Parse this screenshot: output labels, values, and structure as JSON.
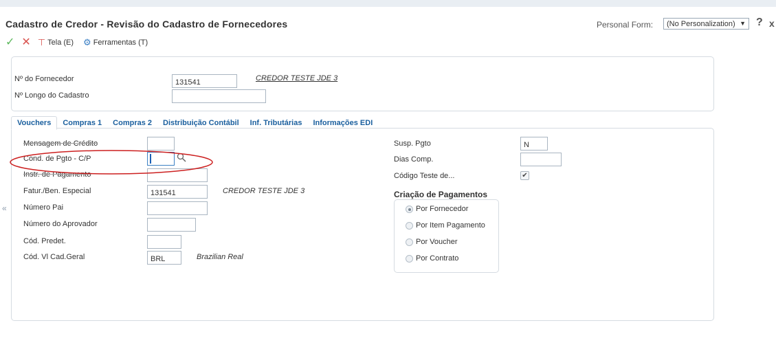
{
  "page": {
    "title": "Cadastro de Credor - Revisão do Cadastro de Fornecedores",
    "personal_form_label": "Personal Form:",
    "personal_form_value": "(No Personalization)",
    "help_glyph": "?",
    "close_glyph": "x"
  },
  "toolbar": {
    "ok_icon": "checkmark-icon",
    "cancel_icon": "x-icon",
    "tela_label": "Tela (E)",
    "ferramentas_label": "Ferramentas (T)"
  },
  "header": {
    "supplier_number_label": "Nº do Fornecedor",
    "supplier_number_value": "131541",
    "supplier_name": "CREDOR TESTE JDE 3",
    "long_number_label": "Nº Longo do Cadastro",
    "long_number_value": ""
  },
  "tabs": [
    {
      "label": "Vouchers",
      "active": true
    },
    {
      "label": "Compras 1"
    },
    {
      "label": "Compras 2"
    },
    {
      "label": "Distribuição Contábil"
    },
    {
      "label": "Inf. Tributárias"
    },
    {
      "label": "Informações EDI"
    }
  ],
  "collapse_glyph": "«",
  "left_fields": {
    "credit_message_label": "Mensagem de Crédito",
    "credit_message_value": "",
    "payment_terms_label": "Cond. de Pgto - C/P",
    "payment_terms_value": "",
    "payment_instr_label": "Instr. de Pagamento",
    "payment_instr_value": "",
    "special_payee_label": "Fatur./Ben. Especial",
    "special_payee_value": "131541",
    "special_payee_name": "CREDOR TESTE JDE 3",
    "parent_number_label": "Número Pai",
    "parent_number_value": "",
    "approver_label": "Número do Aprovador",
    "approver_value": "",
    "default_code_label": "Cód. Predet.",
    "default_code_value": "",
    "currency_label": "Cód. Vl Cad.Geral",
    "currency_value": "BRL",
    "currency_name": "Brazilian Real"
  },
  "right_fields": {
    "payment_hold_label": "Susp. Pgto",
    "payment_hold_value": "N",
    "comp_days_label": "Dias Comp.",
    "comp_days_value": "",
    "test_code_label": "Código Teste de...",
    "test_code_checked": true,
    "test_code_glyph": "✔"
  },
  "payment_creation": {
    "title": "Criação de Pagamentos",
    "options": [
      {
        "label": "Por Fornecedor",
        "selected": true
      },
      {
        "label": "Por Item Pagamento",
        "selected": false
      },
      {
        "label": "Por Voucher",
        "selected": false
      },
      {
        "label": "Por Contrato",
        "selected": false
      }
    ]
  },
  "colors": {
    "accent_blue": "#1a5f9e",
    "annotation_red": "#cc1f1f",
    "ok_green": "#5cb85c",
    "cancel_red": "#d9534f"
  }
}
